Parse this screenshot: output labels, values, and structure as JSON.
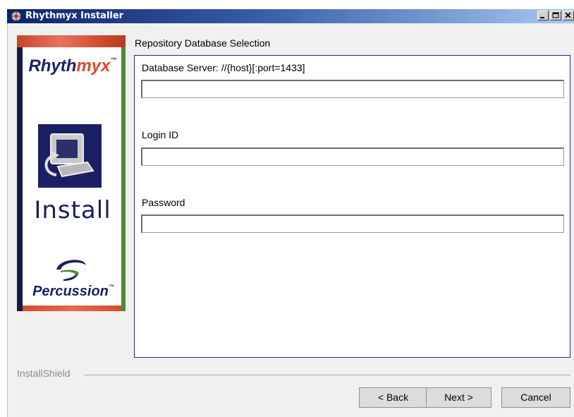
{
  "window": {
    "title": "Rhythmyx Installer",
    "title_icon": "installer-app-icon",
    "controls": {
      "minimize": "_",
      "maximize": "□",
      "close": "✕"
    }
  },
  "banner": {
    "brand_prefix": "Rhyth",
    "brand_suffix": "myx",
    "brand_mark": "™",
    "install_label": "Install",
    "vendor_name": "Percussion",
    "vendor_mark": "™"
  },
  "panel": {
    "title": "Repository Database Selection",
    "fields": [
      {
        "label": "Database Server: //{host}[:port=1433]",
        "value": ""
      },
      {
        "label": "Login ID",
        "value": ""
      },
      {
        "label": "Password",
        "value": ""
      }
    ]
  },
  "footer": {
    "installshield_label": "InstallShield",
    "back_label": "< Back",
    "next_label": "Next >",
    "cancel_label": "Cancel"
  },
  "colors": {
    "titlebar_start": "#0a246a",
    "titlebar_end": "#a6caf0",
    "panel_border": "#1c2d83",
    "brand_navy": "#1b1f63",
    "brand_accent": "#e0472a",
    "banner_green": "#4c8a3a"
  }
}
